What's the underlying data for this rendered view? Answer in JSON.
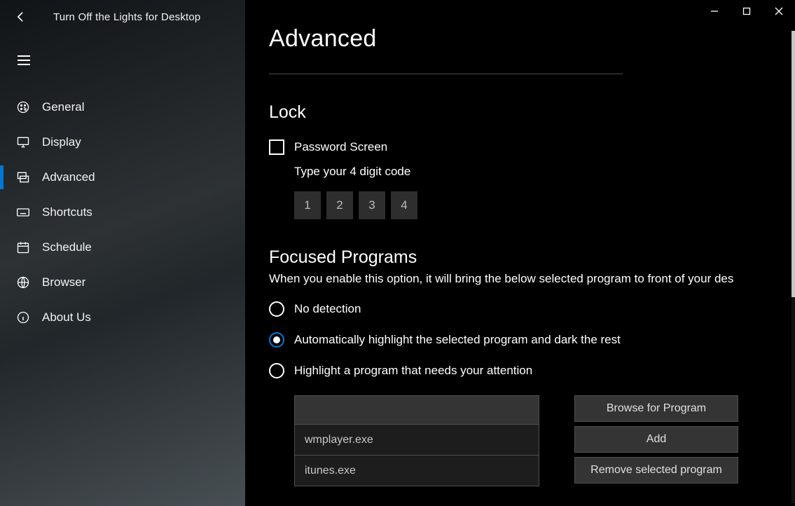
{
  "app": {
    "title": "Turn Off the Lights for Desktop"
  },
  "sidebar": {
    "items": [
      {
        "label": "General",
        "icon": "palette-icon"
      },
      {
        "label": "Display",
        "icon": "monitor-icon"
      },
      {
        "label": "Advanced",
        "icon": "layers-icon"
      },
      {
        "label": "Shortcuts",
        "icon": "keyboard-icon"
      },
      {
        "label": "Schedule",
        "icon": "calendar-icon"
      },
      {
        "label": "Browser",
        "icon": "globe-icon"
      },
      {
        "label": "About Us",
        "icon": "info-icon"
      }
    ],
    "active_index": 2
  },
  "page": {
    "title": "Advanced",
    "lock": {
      "heading": "Lock",
      "password_screen_label": "Password Screen",
      "password_screen_checked": false,
      "code_label": "Type your 4 digit code",
      "digits": [
        "1",
        "2",
        "3",
        "4"
      ]
    },
    "focused": {
      "heading": "Focused Programs",
      "description": "When you enable this option, it will bring the below selected program to front of your des",
      "radios": [
        {
          "label": "No detection",
          "selected": false
        },
        {
          "label": "Automatically highlight the selected program and dark the rest",
          "selected": true
        },
        {
          "label": "Highlight a program that needs your attention",
          "selected": false
        }
      ],
      "input_value": "",
      "list": [
        "wmplayer.exe",
        "itunes.exe"
      ],
      "buttons": {
        "browse": "Browse for Program",
        "add": "Add",
        "remove": "Remove selected program"
      }
    }
  }
}
